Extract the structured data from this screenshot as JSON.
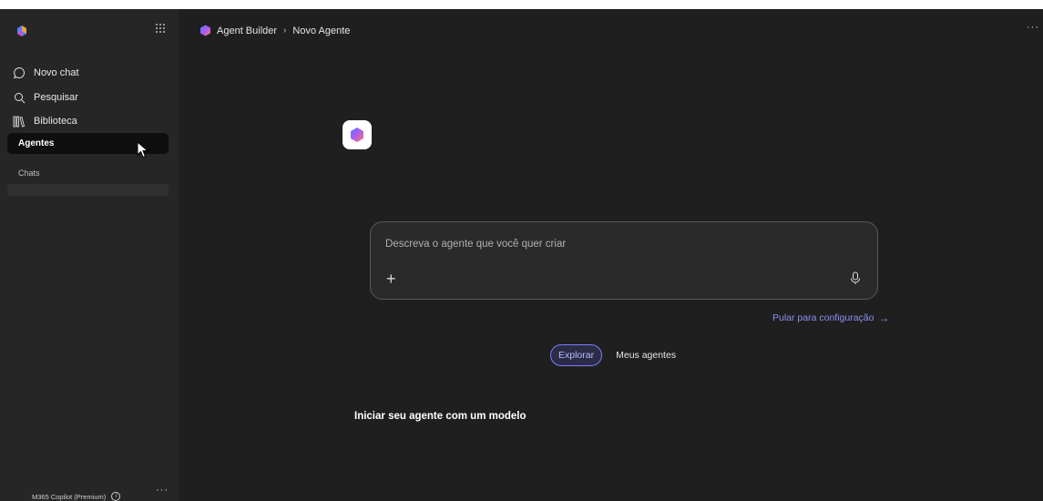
{
  "sidebar": {
    "nav": [
      {
        "label": "Novo chat",
        "icon": "chat-bubble-icon"
      },
      {
        "label": "Pesquisar",
        "icon": "search-icon"
      },
      {
        "label": "Biblioteca",
        "icon": "library-icon"
      }
    ],
    "agents_label": "Agentes",
    "chats_label": "Chats",
    "footer_label": "M365 Copilot (Premium)",
    "more_label": "···",
    "apps_icon": "app-grid-icon"
  },
  "header": {
    "breadcrumb": [
      "Agent Builder",
      "Novo Agente"
    ],
    "separator": "›",
    "more_label": "···"
  },
  "prompt": {
    "placeholder": "Descreva o agente que você quer criar",
    "value": "",
    "add_label": "+"
  },
  "skip_link": {
    "label": "Pular para configuração",
    "arrow": "→"
  },
  "tabs": {
    "explore": "Explorar",
    "mine": "Meus agentes",
    "active": "Explorar"
  },
  "section_title": "Iniciar seu agente com um modelo",
  "colors": {
    "background": "#1f1f1f",
    "sidebar": "#262626",
    "accent": "#7b7bff",
    "link": "#8f8ff5"
  }
}
